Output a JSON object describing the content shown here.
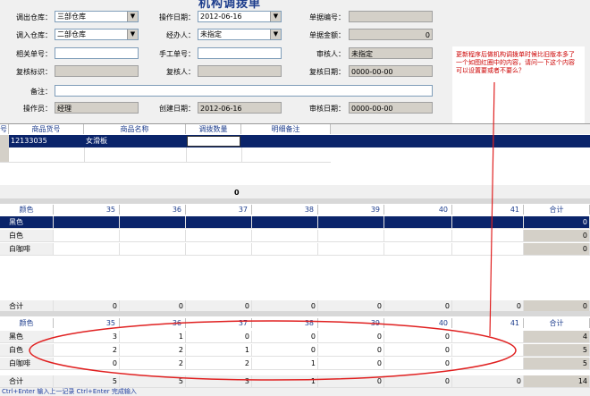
{
  "form": {
    "title": "机构调拨单",
    "row1": {
      "out_wh_label": "调出仓库：",
      "out_wh": "三部仓库",
      "op_date_label": "操作日期：",
      "op_date": "2012-06-16",
      "doc_no_label": "单据编号：",
      "doc_no": ""
    },
    "row2": {
      "in_wh_label": "调入仓库：",
      "in_wh": "二部仓库",
      "handler_label": "经办人：",
      "handler": "未指定",
      "amount_label": "单据金额：",
      "amount": "0"
    },
    "row3": {
      "rel_no_label": "相关单号：",
      "rel_no": "",
      "manual_no_label": "手工单号：",
      "manual_no": "",
      "auditor_label": "审核人：",
      "auditor": "未指定"
    },
    "row4": {
      "recheck_flag_label": "复核标识：",
      "recheck_flag": "",
      "rechecker_label": "复核人：",
      "rechecker": "",
      "recheck_date_label": "复核日期：",
      "recheck_date": "0000-00-00"
    },
    "row5": {
      "remark_label": "备注：",
      "remark": ""
    },
    "row6": {
      "operator_label": "操作员：",
      "operator": "经理",
      "create_date_label": "创建日期：",
      "create_date": "2012-06-16",
      "audit_date_label": "审核日期：",
      "audit_date": "0000-00-00"
    }
  },
  "annotation": "更新程序后做机构调拨单时候比旧版本多了一个如图红圈中的内容，请问一下这个内容可以设置要或者不要么？",
  "items_grid": {
    "headers": [
      "号",
      "商品货号",
      "商品名称",
      "调拨数量",
      "明细备注"
    ],
    "rows": [
      {
        "code": "12133035",
        "name": "女滑板",
        "qty": "",
        "remark": ""
      }
    ],
    "total": "0"
  },
  "size_grid_top": {
    "headers": [
      "颜色",
      "35",
      "36",
      "37",
      "38",
      "39",
      "40",
      "41",
      "合计"
    ],
    "rows": [
      {
        "color": "黑色",
        "values": [
          "",
          "",
          "",
          "",
          "",
          "",
          ""
        ],
        "total": "0"
      },
      {
        "color": "白色",
        "values": [
          "",
          "",
          "",
          "",
          "",
          "",
          ""
        ],
        "total": "0"
      },
      {
        "color": "白咖啡",
        "values": [
          "",
          "",
          "",
          "",
          "",
          "",
          ""
        ],
        "total": "0"
      }
    ],
    "footer": {
      "label": "合计",
      "values": [
        "0",
        "0",
        "0",
        "0",
        "0",
        "0",
        "0"
      ],
      "total": "0"
    }
  },
  "size_grid_bottom": {
    "headers": [
      "颜色",
      "35",
      "36",
      "37",
      "38",
      "39",
      "40",
      "41",
      "合计"
    ],
    "rows": [
      {
        "color": "黑色",
        "values": [
          "3",
          "1",
          "0",
          "0",
          "0",
          "0",
          ""
        ],
        "total": "4"
      },
      {
        "color": "白色",
        "values": [
          "2",
          "2",
          "1",
          "0",
          "0",
          "0",
          ""
        ],
        "total": "5"
      },
      {
        "color": "白咖啡",
        "values": [
          "0",
          "2",
          "2",
          "1",
          "0",
          "0",
          ""
        ],
        "total": "5"
      }
    ],
    "footer": {
      "label": "合计",
      "values": [
        "5",
        "5",
        "3",
        "1",
        "0",
        "0",
        "0"
      ],
      "total": "14"
    }
  },
  "status_bar": "Ctrl+Enter 输入上一记录  Ctrl+Enter 完成输入",
  "colors": {
    "selection": "#0a246a",
    "header_text": "#1c3c8c",
    "annotation_text": "#cc0000",
    "ellipse": "#e02020"
  }
}
